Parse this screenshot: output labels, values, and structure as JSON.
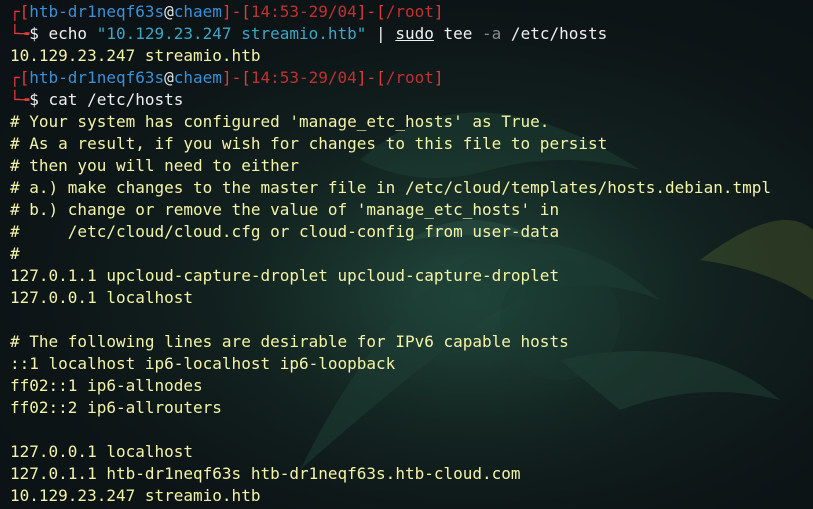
{
  "prompt1": {
    "bracket_top": "┌[",
    "user": "htb-dr1neqf63s",
    "at": "@",
    "host": "chaem",
    "sep1": "]-[",
    "time": "14:53-29/04",
    "sep2": "]-[",
    "path": "/root",
    "close": "]",
    "bracket_bottom": "└╼",
    "dollar": "$ ",
    "cmd": "echo",
    "arg": "\"10.129.23.247 streamio.htb\"",
    "pipe": " | ",
    "sudo": "sudo",
    "tee": " tee ",
    "flag": "-a",
    "file": " /etc/hosts"
  },
  "output1": "10.129.23.247 streamio.htb",
  "prompt2": {
    "bracket_top": "┌[",
    "user": "htb-dr1neqf63s",
    "at": "@",
    "host": "chaem",
    "sep1": "]-[",
    "time": "14:53-29/04",
    "sep2": "]-[",
    "path": "/root",
    "close": "]",
    "bracket_bottom": "└╼",
    "dollar": "$ ",
    "cmd": "cat",
    "file": " /etc/hosts"
  },
  "hosts_lines": [
    "# Your system has configured 'manage_etc_hosts' as True.",
    "# As a result, if you wish for changes to this file to persist",
    "# then you will need to either",
    "# a.) make changes to the master file in /etc/cloud/templates/hosts.debian.tmpl",
    "# b.) change or remove the value of 'manage_etc_hosts' in",
    "#     /etc/cloud/cloud.cfg or cloud-config from user-data",
    "#",
    "127.0.1.1 upcloud-capture-droplet upcloud-capture-droplet",
    "127.0.0.1 localhost",
    "",
    "# The following lines are desirable for IPv6 capable hosts",
    "::1 localhost ip6-localhost ip6-loopback",
    "ff02::1 ip6-allnodes",
    "ff02::2 ip6-allrouters",
    "",
    "127.0.0.1 localhost",
    "127.0.1.1 htb-dr1neqf63s htb-dr1neqf63s.htb-cloud.com",
    "10.129.23.247 streamio.htb"
  ]
}
